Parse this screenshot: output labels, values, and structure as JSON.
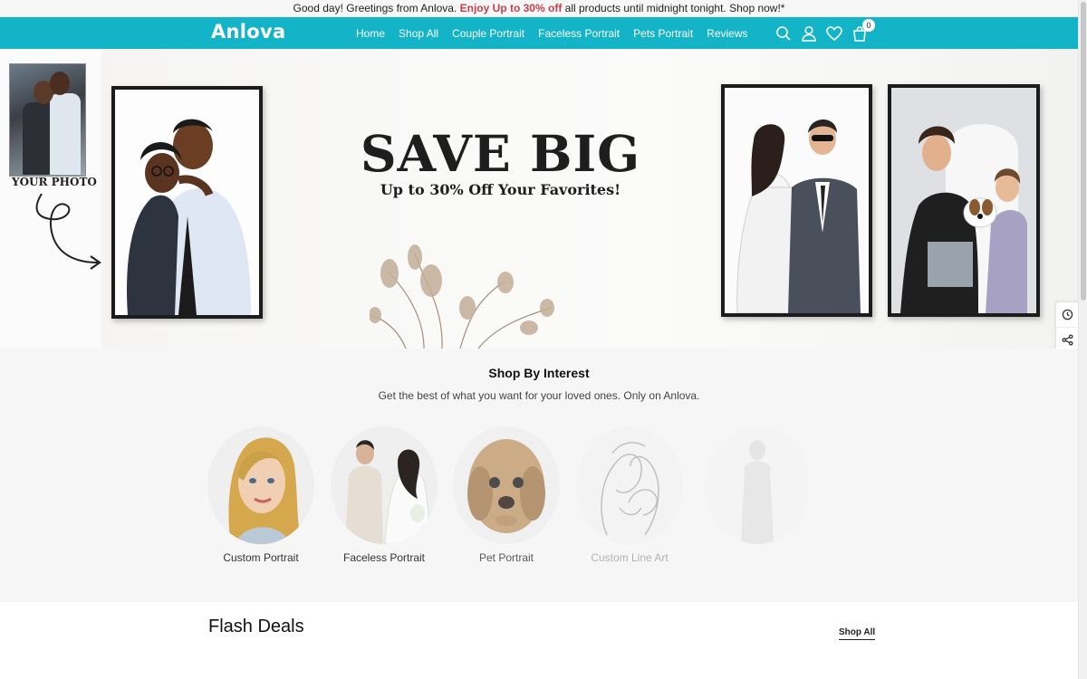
{
  "announcement": {
    "prefix": "Good day! Greetings from Anlova.",
    "highlight": "Enjoy Up to 30% off",
    "suffix": "all products until midnight tonight. Shop now!*"
  },
  "header": {
    "logo": "Anlova",
    "nav": [
      "Home",
      "Shop All",
      "Couple Portrait",
      "Faceless Portrait",
      "Pets Portrait",
      "Reviews"
    ],
    "cart_count": "0"
  },
  "hero": {
    "your_photo_label": "YOUR PHOTO",
    "headline": "SAVE BIG",
    "subline": "Up to 30% Off Your Favorites!"
  },
  "interest": {
    "title": "Shop By Interest",
    "subtitle": "Get the best of what you want for your loved ones. Only on Anlova.",
    "categories": [
      {
        "label": "Custom Portrait"
      },
      {
        "label": "Faceless Portrait"
      },
      {
        "label": "Pet Portrait"
      },
      {
        "label": "Custom Line Art"
      },
      {
        "label": ""
      }
    ]
  },
  "flash": {
    "title": "Flash Deals",
    "shop_all": "Shop All"
  }
}
